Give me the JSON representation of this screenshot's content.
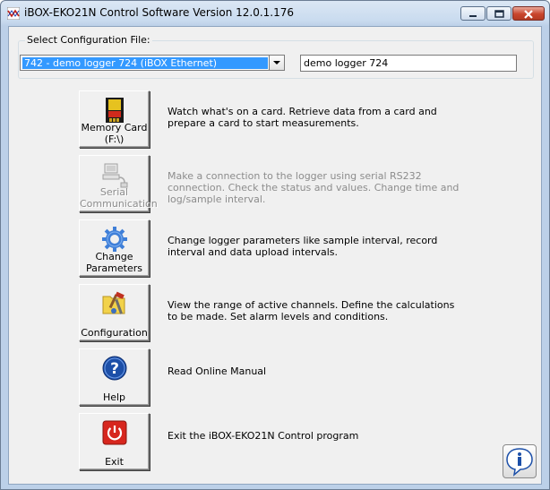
{
  "window": {
    "title": "iBOX-EKO21N Control Software Version 12.0.1.176"
  },
  "config": {
    "group_label": "Select Configuration File:",
    "selected_file": "742 - demo logger 724 (iBOX Ethernet)",
    "logger_name": "demo logger 724"
  },
  "actions": [
    {
      "label1": "Memory Card",
      "label2": "(F:\\)",
      "description": "Watch what's on a card. Retrieve data from a card and prepare a card to start measurements.",
      "enabled": true,
      "icon": "memory-card-icon"
    },
    {
      "label1": "Serial",
      "label2": "Communication",
      "description": "Make a connection to the logger using serial RS232 connection. Check the status and values. Change time and log/sample interval.",
      "enabled": false,
      "icon": "serial-computer-icon"
    },
    {
      "label1": "Change",
      "label2": "Parameters",
      "description": "Change logger parameters like sample interval, record interval and data upload intervals.",
      "enabled": true,
      "icon": "gear-icon"
    },
    {
      "label1": "Configuration",
      "label2": "",
      "description": "View the range of active channels. Define the calculations to be made. Set alarm levels and conditions.",
      "enabled": true,
      "icon": "folder-tools-icon"
    },
    {
      "label1": "Help",
      "label2": "",
      "description": "Read Online Manual",
      "enabled": true,
      "icon": "help-icon"
    },
    {
      "label1": "Exit",
      "label2": "",
      "description": "Exit the iBOX-EKO21N Control program",
      "enabled": true,
      "icon": "power-icon"
    }
  ],
  "colors": {
    "selection": "#3399ff",
    "title_bar": "#c9dbef",
    "close_button": "#c9452c",
    "help_blue": "#1c4fa8",
    "exit_red": "#d7261e"
  }
}
